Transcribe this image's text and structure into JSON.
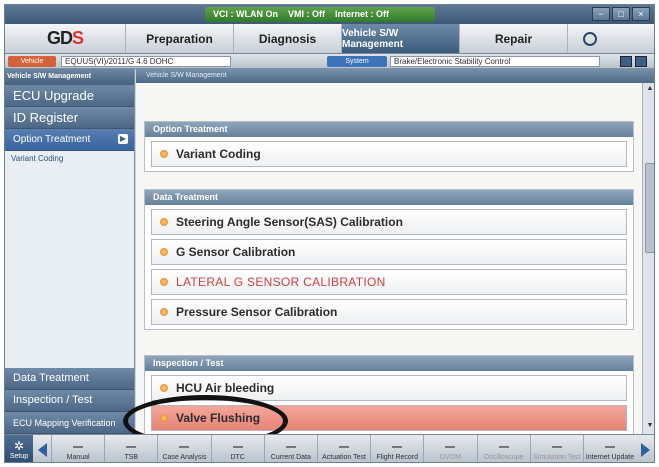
{
  "status": {
    "vci": "VCI : WLAN On",
    "vmi": "VMI : Off",
    "internet": "Internet : Off",
    "window_buttons": [
      "−",
      "□",
      "×"
    ]
  },
  "menu": {
    "logo_text": "GD",
    "logo_accent": "S",
    "items": [
      "Preparation",
      "Diagnosis",
      "Vehicle S/W Management",
      "Repair"
    ]
  },
  "vehicle": {
    "vehicle_btn": "Vehicle",
    "vehicle_value": "EQUUS(VI)/2011/G 4.6 DOHC",
    "system_btn": "System",
    "system_value": "Brake/Electronic Stability Control"
  },
  "sidebar": {
    "header": "Vehicle S/W Management",
    "items": [
      "ECU Upgrade",
      "ID Register",
      "Option Treatment"
    ],
    "sub_item": "Variant Coding",
    "bottom_items": [
      "Data Treatment",
      "Inspection / Test",
      "ECU Mapping Verification"
    ]
  },
  "content": {
    "header": "Vehicle S/W Management",
    "groups": [
      {
        "title": "Option Treatment",
        "rows": [
          "Variant Coding"
        ]
      },
      {
        "title": "Data Treatment",
        "rows": [
          "Steering Angle Sensor(SAS) Calibration",
          "G Sensor Calibration",
          "LATERAL G SENSOR CALIBRATION",
          "Pressure Sensor Calibration"
        ]
      },
      {
        "title": "Inspection / Test",
        "rows": [
          "HCU Air bleeding",
          "Valve Flushing"
        ]
      }
    ]
  },
  "toolbar": {
    "setup": "Setup",
    "items": [
      "Manual",
      "TSB",
      "Case Analysis",
      "DTC",
      "Current Data",
      "Actuation Test",
      "Flight Record",
      "DVOM",
      "Oscilloscope",
      "Simulation Test",
      "Internet Update"
    ]
  },
  "colors": {
    "accent_blue": "#3863a0",
    "highlight_red": "#e88476",
    "warning_text": "#cf3e3e"
  }
}
